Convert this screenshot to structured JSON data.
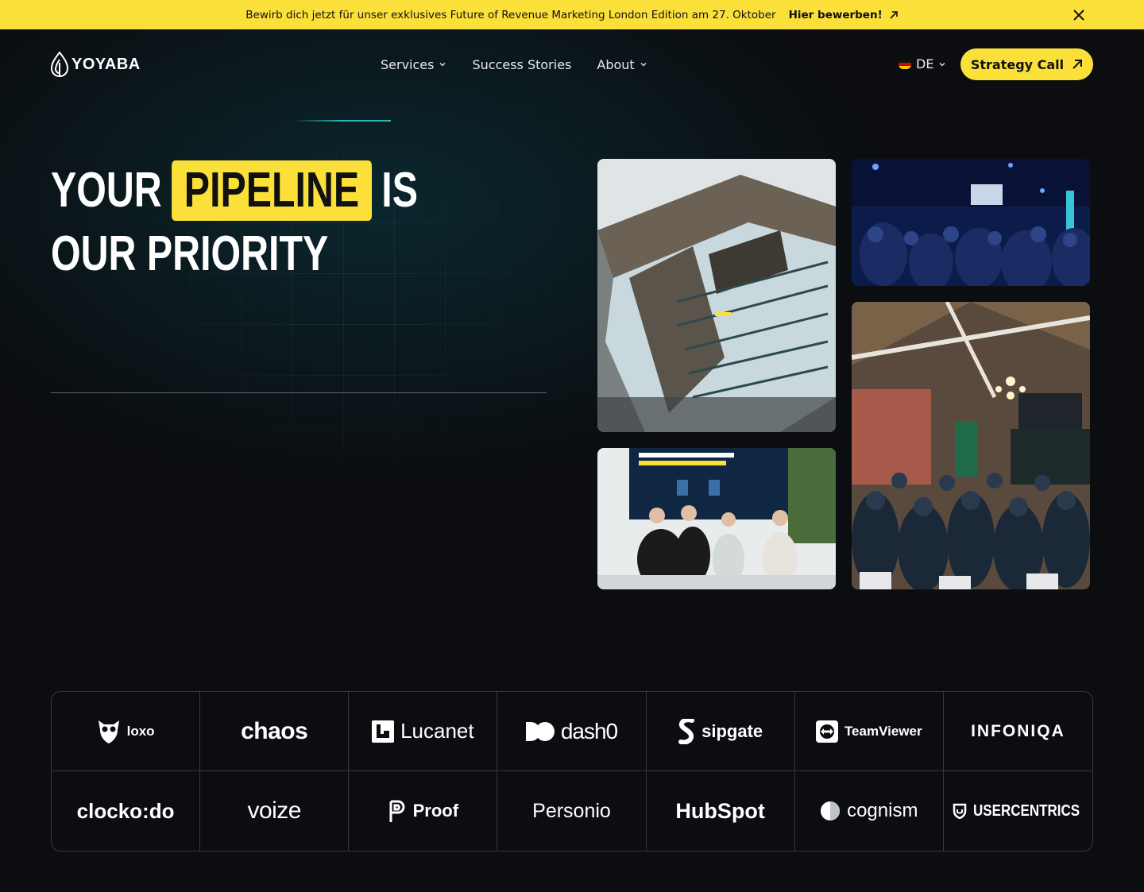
{
  "announcement": {
    "message": "Bewirb dich jetzt für unser exklusives Future of Revenue Marketing London Edition am 27. Oktober",
    "cta_label": "Hier bewerben!"
  },
  "brand": {
    "name": "YOYABA"
  },
  "nav": {
    "items": [
      {
        "label": "Services",
        "has_dropdown": true
      },
      {
        "label": "Success Stories",
        "has_dropdown": false
      },
      {
        "label": "About",
        "has_dropdown": true
      }
    ],
    "language": "DE",
    "cta_label": "Strategy Call"
  },
  "hero": {
    "line1_before": "YOUR",
    "highlight": "PIPELINE",
    "line1_after": "IS",
    "line2": "OUR PRIORITY"
  },
  "client_logos": {
    "row1": [
      "loxo",
      "chaos",
      "Lucanet",
      "dash0",
      "sipgate",
      "TeamViewer",
      "INFONIQA"
    ],
    "row2": [
      "clocko:do",
      "voize",
      "Proof",
      "Personio",
      "HubSpot",
      "cognism",
      "USERCENTRICS"
    ]
  },
  "colors": {
    "accent": "#fbe03a",
    "background": "#0b0d10",
    "teal": "#2bb5b5"
  }
}
